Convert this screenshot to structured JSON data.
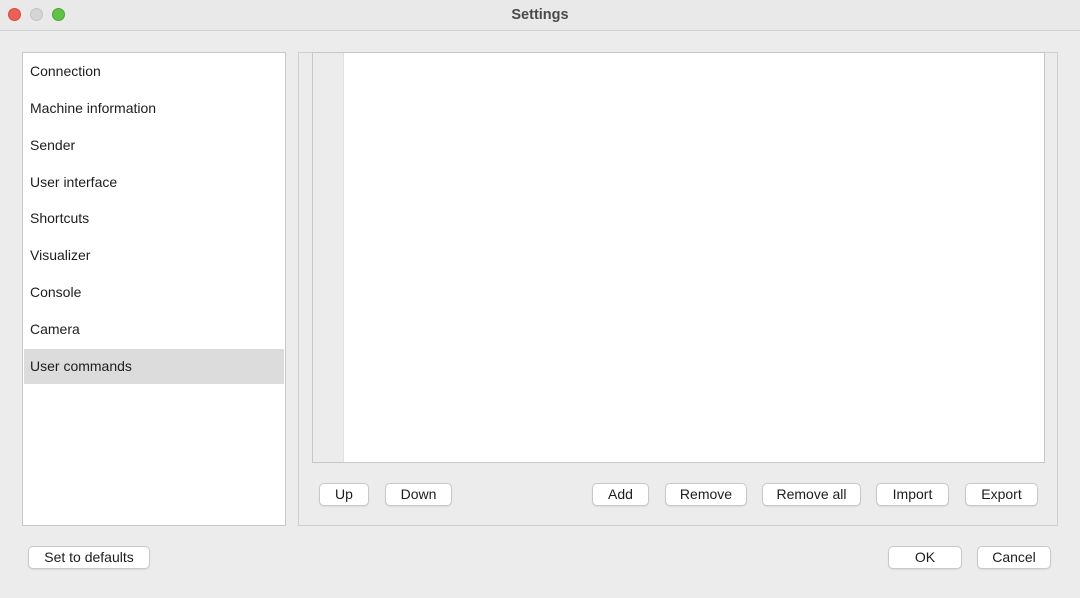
{
  "window": {
    "title": "Settings"
  },
  "sidebar": {
    "items": [
      {
        "label": "Connection"
      },
      {
        "label": "Machine information"
      },
      {
        "label": "Sender"
      },
      {
        "label": "User interface"
      },
      {
        "label": "Shortcuts"
      },
      {
        "label": "Visualizer"
      },
      {
        "label": "Console"
      },
      {
        "label": "Camera"
      },
      {
        "label": "User commands",
        "selected": true
      }
    ]
  },
  "commands_panel": {
    "buttons": {
      "up": "Up",
      "down": "Down",
      "add": "Add",
      "remove": "Remove",
      "remove_all": "Remove all",
      "import": "Import",
      "export": "Export"
    }
  },
  "footer": {
    "set_defaults": "Set to defaults",
    "ok": "OK",
    "cancel": "Cancel"
  },
  "colors": {
    "close": "#ee5f57",
    "minimize": "#d5d5d5",
    "maximize": "#5fc249",
    "selection": "#dcdcdc"
  }
}
